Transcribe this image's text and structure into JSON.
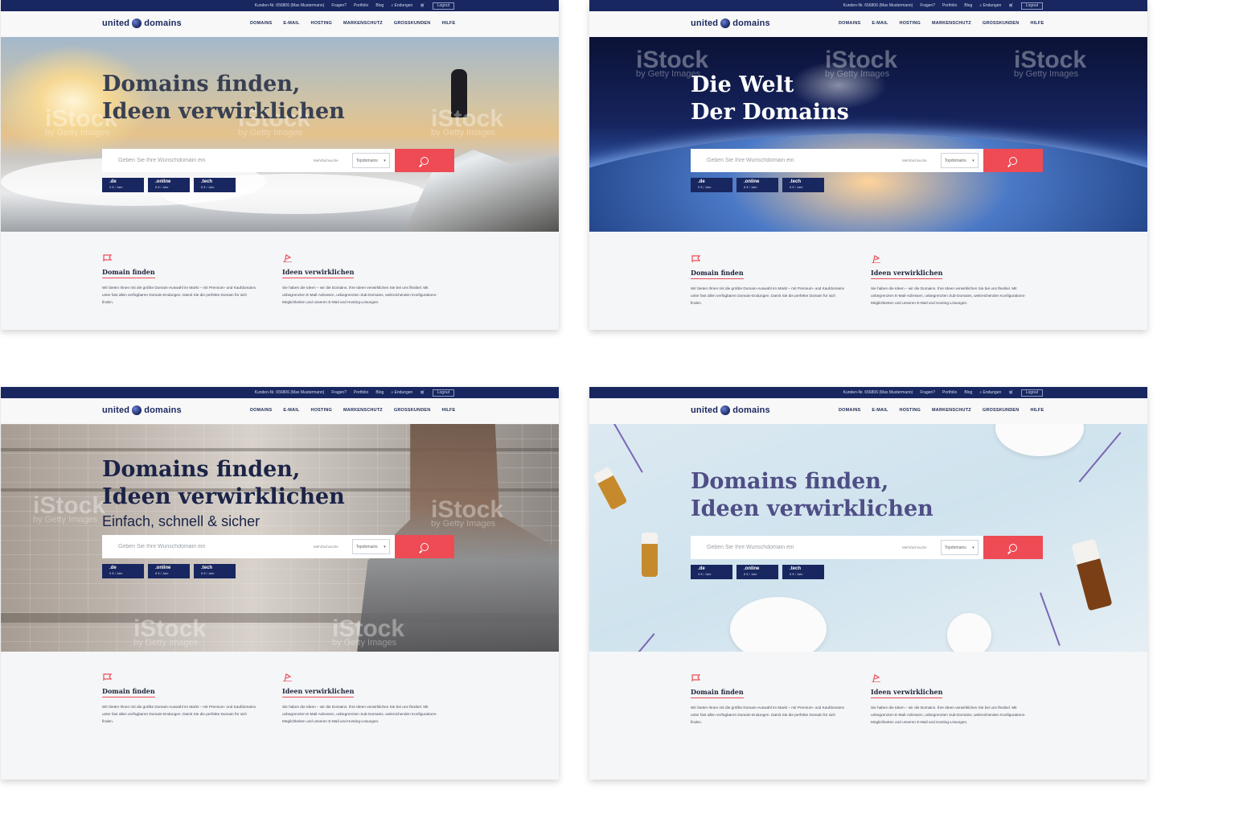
{
  "header": {
    "customer": "Kunden-Nr. 656806 (Max Mustermann)",
    "links": [
      "Fragen?",
      "Portfolio",
      "Blog",
      "Endungen"
    ],
    "logout": "Logout",
    "logo_left": "united",
    "logo_right": "domains",
    "menu": [
      "DOMAINS",
      "E-MAIL",
      "HOSTING",
      "MARKENSCHUTZ",
      "GROSSKUNDEN",
      "HILFE"
    ]
  },
  "search": {
    "placeholder": "Geben Sie Ihre Wunschdomain ein",
    "multi": "Mehrfachsuche",
    "dropdown": "Topdomains"
  },
  "tlds": [
    {
      "name": ".de",
      "price": "9 € / Jahr"
    },
    {
      "name": ".online",
      "price": "8 € / Jahr"
    },
    {
      "name": ".tech",
      "price": "8 € / Jahr"
    }
  ],
  "watermark": {
    "brand": "iStock",
    "by": "by Getty Images"
  },
  "variants": [
    {
      "headline_1": "Domains finden,",
      "headline_2": "Ideen verwirklichen"
    },
    {
      "headline_1": "Die Welt",
      "headline_2": "Der Domains"
    },
    {
      "headline_1": "Domains finden,",
      "headline_2": "Ideen verwirklichen",
      "subline": "Einfach, schnell & sicher"
    },
    {
      "headline_1": "Domains finden,",
      "headline_2": "Ideen verwirklichen"
    }
  ],
  "features": [
    {
      "title": "Domain finden",
      "text": "Wir bieten Ihnen mit die größte Domain-Auswahl im Markt – mit Premium- und Kaufdomains unter fast allen verfügbaren Domain-Endungen. Damit Sie die perfekte Domain für sich finden."
    },
    {
      "title": "Ideen verwirklichen",
      "text": "Sie haben die Ideen – wir die Domains. Ihre Ideen verwirklichen Sie bei uns flexibel. Mit unbegrenzten E-Mail-Adressen, unbegrenzten Sub-Domains, weitreichenden Konfigurations-Möglichkeiten und unseren E-Mail und Hosting-Lösungen."
    }
  ],
  "colors": {
    "navy": "#18275f",
    "accent": "#ee4b55",
    "page_bg": "#f4f6f8"
  },
  "icons": [
    "cart-icon",
    "search-icon",
    "flag-icon",
    "magnifier-icon",
    "chevron-down-icon"
  ]
}
